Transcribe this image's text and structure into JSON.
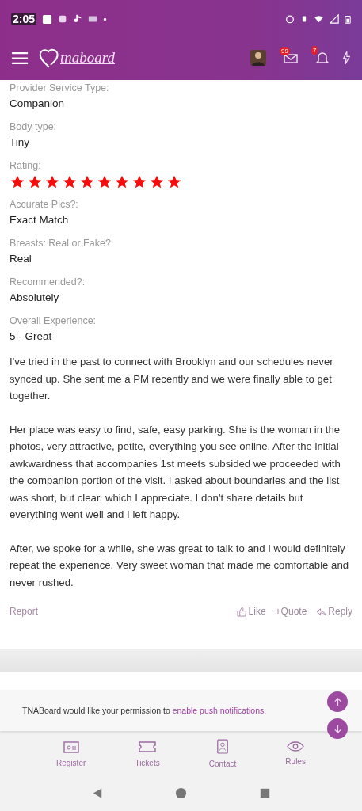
{
  "status_bar": {
    "time": "2:05"
  },
  "header": {
    "logo": "tnaboard",
    "badges": [
      {
        "kind": "messages",
        "count": "99"
      },
      {
        "kind": "alerts",
        "count": "7"
      }
    ]
  },
  "fields": [
    {
      "kind": "text",
      "label": "Provider Service Type:",
      "value": "Companion"
    },
    {
      "kind": "text",
      "label": "Body type:",
      "value": "Tiny"
    },
    {
      "kind": "stars",
      "label": "Rating:",
      "stars": 10
    },
    {
      "kind": "text",
      "label": "Accurate Pics?:",
      "value": "Exact Match"
    },
    {
      "kind": "text",
      "label": "Breasts: Real or Fake?:",
      "value": "Real"
    },
    {
      "kind": "text",
      "label": "Recommended?:",
      "value": "Absolutely"
    },
    {
      "kind": "text",
      "label": "Overall Experience:",
      "value": "5 - Great"
    }
  ],
  "paragraphs": [
    "I've tried in the past to connect with Brooklyn and our schedules never synced up. She sent me a PM recently and we were finally able to get together.",
    "Her place was easy to find, safe, easy parking. She is the woman in the photos, very attractive, petite, everything you see online. After the initial awkwardness that accompanies 1st meets subsided we proceeded with the companion portion of the visit. I asked about boundaries and the list was short, but clear, which I appreciate. I don't share details but everything went well and I left happy.",
    "After, we spoke for a while, she was great to talk to and I would definitely repeat the experience. Very sweet woman that made me comfortable and never rushed."
  ],
  "actions": {
    "report": "Report",
    "like": "Like",
    "quote": "+Quote",
    "reply": "Reply"
  },
  "notification": {
    "text": "TNABoard would like your permission to ",
    "link": "enable push notifications."
  },
  "bottom_nav": [
    {
      "kind": "register",
      "label": "Register"
    },
    {
      "kind": "tickets",
      "label": "Tickets"
    },
    {
      "kind": "contact",
      "label": "Contact"
    },
    {
      "kind": "rules",
      "label": "Rules"
    }
  ]
}
